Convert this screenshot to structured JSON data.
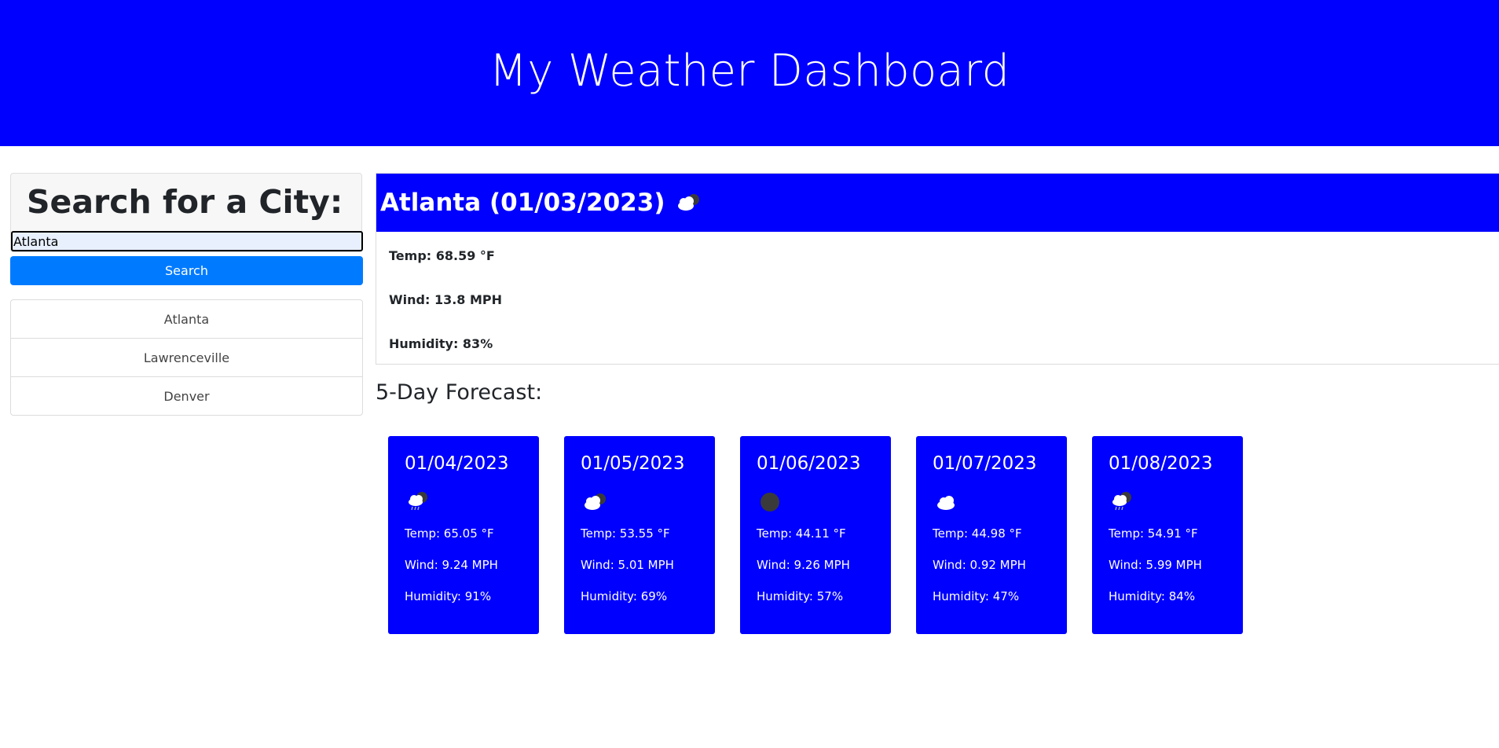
{
  "header": {
    "title": "My Weather Dashboard"
  },
  "search": {
    "title": "Search for a City:",
    "input_value": "Atlanta",
    "button_label": "Search"
  },
  "history": [
    "Atlanta",
    "Lawrenceville",
    "Denver"
  ],
  "current": {
    "heading": "Atlanta (01/03/2023)",
    "icon": "partly-cloudy-icon",
    "temp": "Temp: 68.59 °F",
    "wind": "Wind: 13.8 MPH",
    "humidity": "Humidity: 83%"
  },
  "forecast": {
    "title": "5-Day Forecast:",
    "days": [
      {
        "date": "01/04/2023",
        "icon": "rain-icon",
        "temp": "Temp: 65.05 °F",
        "wind": "Wind: 9.24 MPH",
        "humidity": "Humidity: 91%"
      },
      {
        "date": "01/05/2023",
        "icon": "partly-cloudy-icon",
        "temp": "Temp: 53.55 °F",
        "wind": "Wind: 5.01 MPH",
        "humidity": "Humidity: 69%"
      },
      {
        "date": "01/06/2023",
        "icon": "overcast-icon",
        "temp": "Temp: 44.11 °F",
        "wind": "Wind: 9.26 MPH",
        "humidity": "Humidity: 57%"
      },
      {
        "date": "01/07/2023",
        "icon": "cloud-icon",
        "temp": "Temp: 44.98 °F",
        "wind": "Wind: 0.92 MPH",
        "humidity": "Humidity: 47%"
      },
      {
        "date": "01/08/2023",
        "icon": "rain-icon",
        "temp": "Temp: 54.91 °F",
        "wind": "Wind: 5.99 MPH",
        "humidity": "Humidity: 84%"
      }
    ]
  },
  "colors": {
    "brand": "#0000ff",
    "button": "#007bff"
  }
}
